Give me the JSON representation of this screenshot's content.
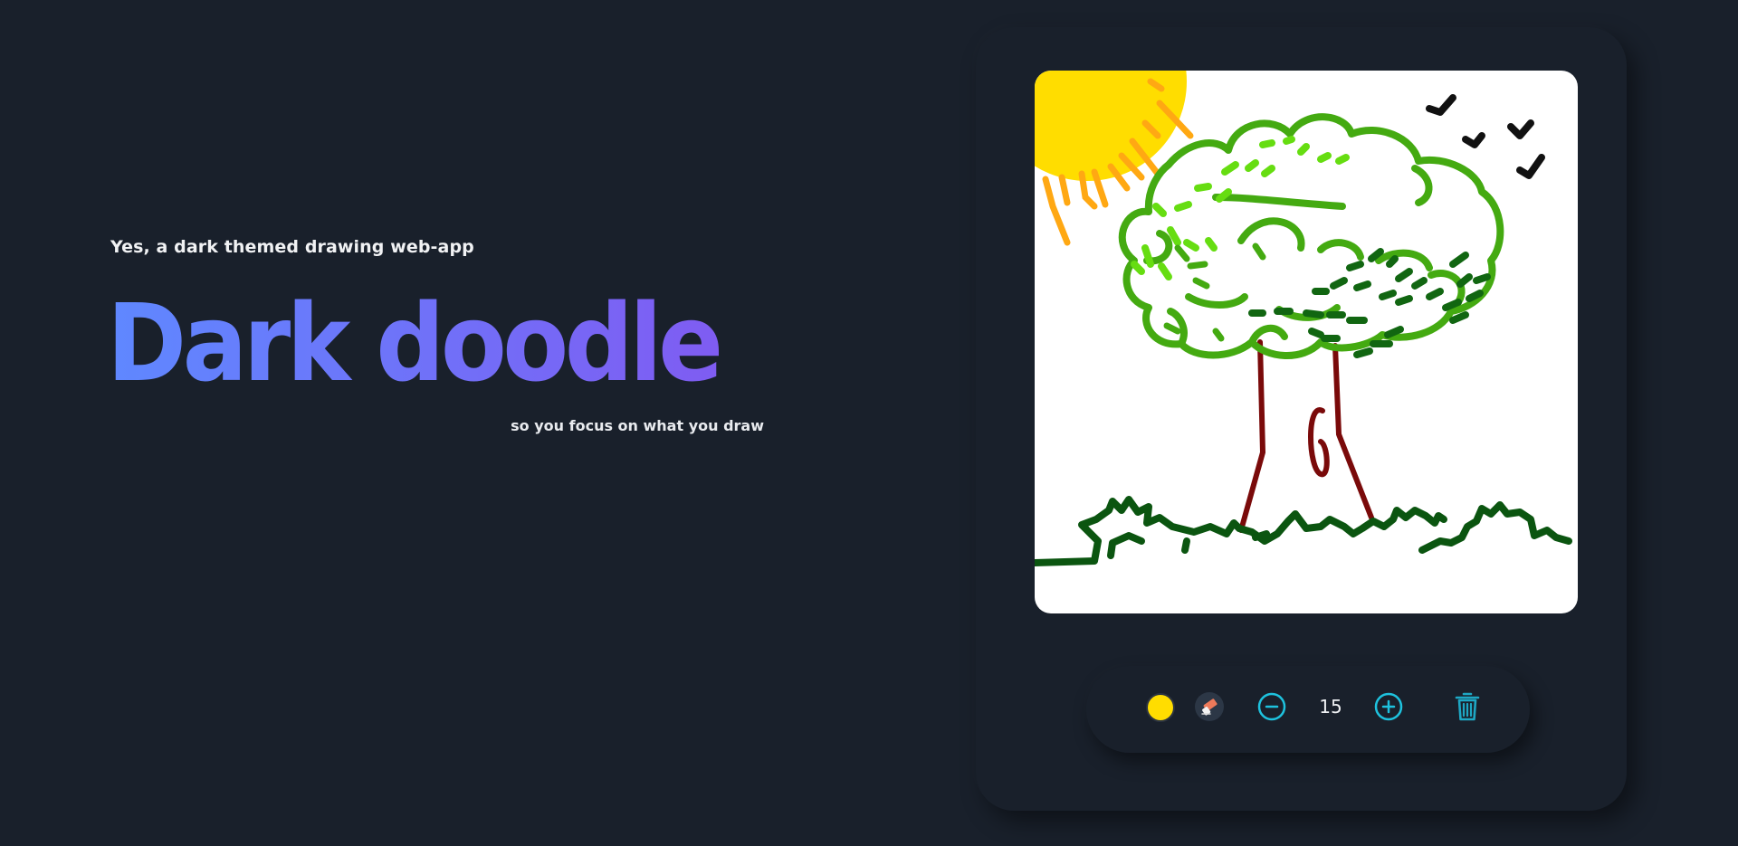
{
  "hero": {
    "eyebrow": "Yes, a dark themed drawing web-app",
    "title": "Dark doodle",
    "tagline": "so you focus on what you draw",
    "gradient_start": "#5f88ff",
    "gradient_end": "#7f5cf2"
  },
  "toolbar": {
    "current_color": "#ffdd00",
    "brush_size": "15",
    "accent_color": "#1ec2de",
    "icons": [
      "color-swatch",
      "eraser-icon",
      "minus-circle-icon",
      "plus-circle-icon",
      "trash-icon"
    ]
  },
  "canvas": {
    "background": "#ffffff",
    "drawing": "tree with sun and birds",
    "colors": {
      "sun": "#ffdd00",
      "rays": "#ffa813",
      "canopy": "#44aa11",
      "canopy_light": "#66dd11",
      "canopy_dark": "#116611",
      "trunk": "#7a0a0a",
      "grass": "#0b5510",
      "birds": "#111111"
    }
  }
}
